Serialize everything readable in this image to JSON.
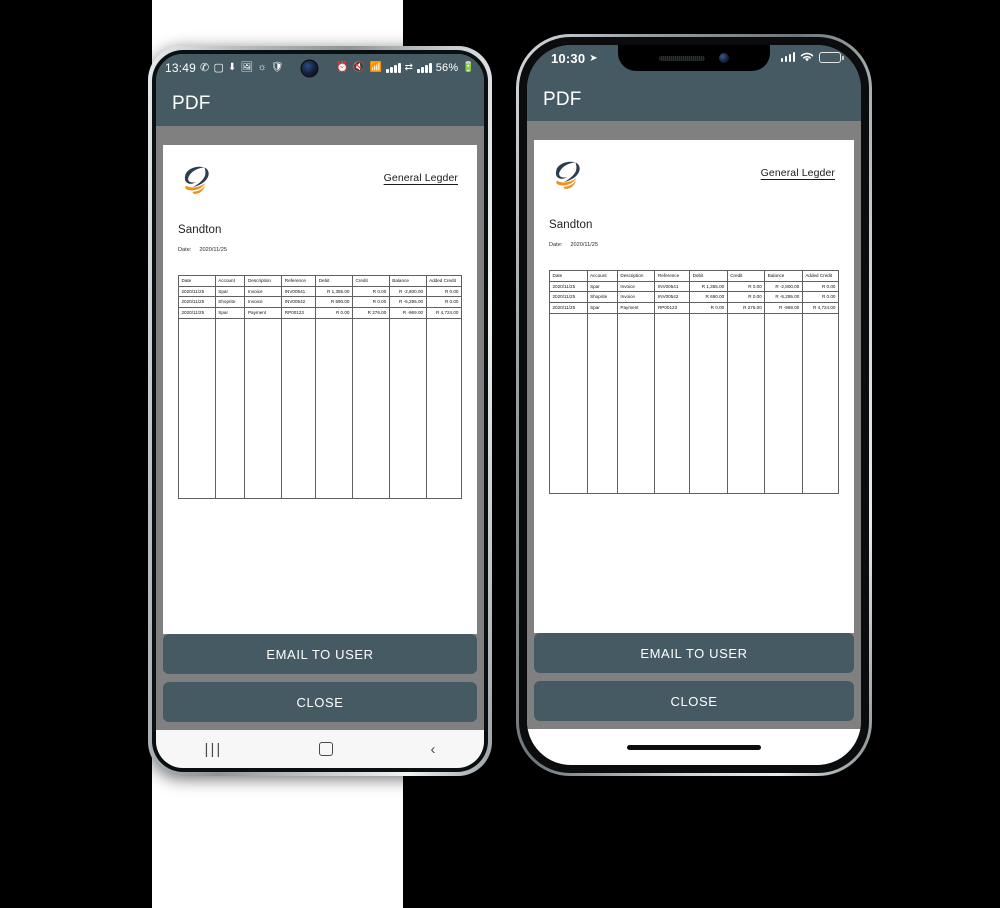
{
  "android": {
    "status_bar": {
      "time": "13:49",
      "left_icons": [
        "whatsapp-icon",
        "instagram-icon",
        "download-icon",
        "gallery-icon",
        "goggles-icon",
        "shield-icon"
      ],
      "punch_hole": "front-camera",
      "right_icons": [
        "alarm-icon",
        "mute-icon",
        "wifi-icon",
        "signal-icon",
        "sim-swap-icon",
        "signal2-icon"
      ],
      "battery_percent": "56%"
    },
    "app_bar": {
      "title": "PDF"
    },
    "nav_bar": {
      "recents": "|||",
      "home": "home-square",
      "back": "‹"
    }
  },
  "iphone": {
    "status_bar": {
      "time": "10:30",
      "location_icon": "location-arrow-icon",
      "cellular": "signal-bars-icon",
      "wifi": "wifi-icon",
      "battery": "battery-icon"
    },
    "app_bar": {
      "title": "PDF"
    },
    "home_indicator": "home-indicator-bar"
  },
  "document": {
    "logo_alt": "company-swoosh-logo",
    "title": "General Legder",
    "branch": "Sandton",
    "date_label": "Date:",
    "date_value": "2020/11/25",
    "table": {
      "headers": [
        "Date",
        "Account",
        "Description",
        "Reference",
        "Debit",
        "Credit",
        "Balance",
        "Added Credit"
      ],
      "rows": [
        {
          "date": "2020/11/25",
          "account": "Spar",
          "description": "Invoice",
          "reference": "INV00541",
          "debit": "R 1,355.00",
          "credit": "R 0.00",
          "balance": "R -2,800.00",
          "added_credit": "R 0.00"
        },
        {
          "date": "2020/11/25",
          "account": "Shoprite",
          "description": "Invoice",
          "reference": "INV00542",
          "debit": "R 690.00",
          "credit": "R 0.00",
          "balance": "R -5,295.00",
          "added_credit": "R 0.00"
        },
        {
          "date": "2020/11/25",
          "account": "Spar",
          "description": "Payment",
          "reference": "RP00123",
          "debit": "R 0.00",
          "credit": "R 276.00",
          "balance": "R -969.00",
          "added_credit": "R 4,724.00"
        }
      ]
    }
  },
  "actions": {
    "email_label": "EMAIL TO USER",
    "close_label": "CLOSE"
  },
  "colors": {
    "app_bar": "#455A62",
    "backdrop": "#808080",
    "logo_dark": "#2b3d4f",
    "logo_orange": "#f0901e",
    "battery_yellow": "#f6c700"
  }
}
